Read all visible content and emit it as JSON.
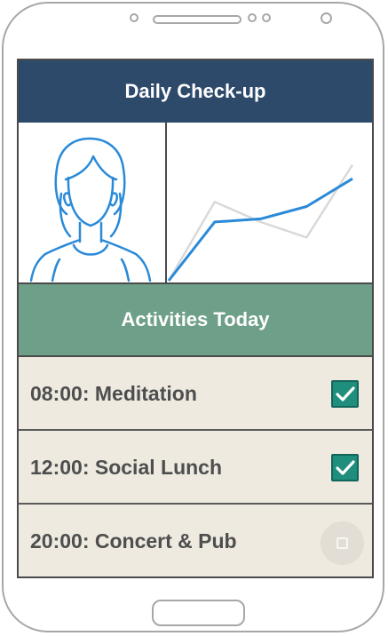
{
  "header": {
    "title": "Daily Check-up"
  },
  "section": {
    "title": "Activities Today"
  },
  "activities": [
    {
      "label": "08:00: Meditation",
      "done": true
    },
    {
      "label": "12:00: Social Lunch",
      "done": true
    },
    {
      "label": "20:00: Concert & Pub",
      "done": false
    }
  ],
  "chart_data": {
    "type": "line",
    "series": [
      {
        "values": [
          0,
          38,
          40,
          48,
          66
        ],
        "color": "#2a8ad8"
      },
      {
        "values": [
          0,
          51,
          38,
          28,
          75
        ],
        "color": "#d9d9d9"
      }
    ],
    "ylim": [
      0,
      100
    ]
  },
  "colors": {
    "header_bg": "#2e4a6b",
    "section_bg": "#6e9f88",
    "row_bg": "#eeeae0",
    "check": "#1f8e7c",
    "avatar_stroke": "#2a8ad8"
  },
  "icons": {
    "avatar": "woman-avatar-icon",
    "checked": "checkbox-checked-icon",
    "unchecked": "checkbox-unchecked-icon"
  }
}
